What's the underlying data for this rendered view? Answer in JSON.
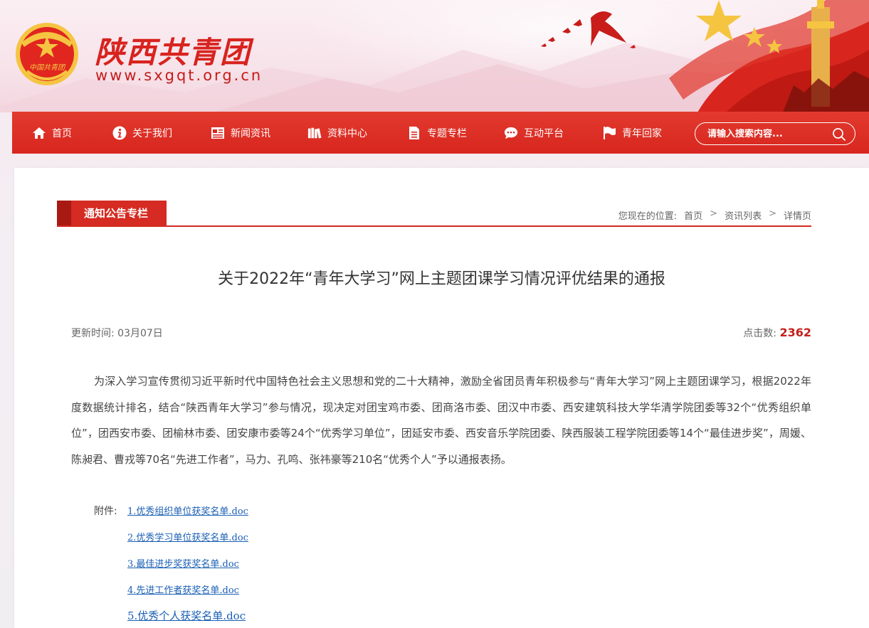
{
  "header": {
    "site_title": "陕西共青团",
    "site_url": "www.sxgqt.org.cn",
    "emblem_text": "中国共青团"
  },
  "nav": {
    "items": [
      {
        "label": "首页",
        "icon": "home-icon"
      },
      {
        "label": "关于我们",
        "icon": "info-icon"
      },
      {
        "label": "新闻资讯",
        "icon": "news-icon"
      },
      {
        "label": "资料中心",
        "icon": "books-icon"
      },
      {
        "label": "专题专栏",
        "icon": "document-icon"
      },
      {
        "label": "互动平台",
        "icon": "chat-icon"
      },
      {
        "label": "青年回家",
        "icon": "flag-icon"
      }
    ],
    "search_placeholder": "请输入搜索内容..."
  },
  "section": {
    "tab_label": "通知公告专栏",
    "breadcrumb_prefix": "您现在的位置:",
    "breadcrumb": [
      "首页",
      "资讯列表",
      "详情页"
    ],
    "breadcrumb_sep": ">"
  },
  "article": {
    "title": "关于2022年“青年大学习”网上主题团课学习情况评优结果的通报",
    "update_label": "更新时间:",
    "update_date": "03月07日",
    "clicks_label": "点击数:",
    "clicks": "2362",
    "body": "为深入学习宣传贯彻习近平新时代中国特色社会主义思想和党的二十大精神，激励全省团员青年积极参与“青年大学习”网上主题团课学习，根据2022年度数据统计排名，结合“陕西青年大学习”参与情况，现决定对团宝鸡市委、团商洛市委、团汉中市委、西安建筑科技大学华清学院团委等32个“优秀组织单位”，团西安市委、团榆林市委、团安康市委等24个“优秀学习单位”，团延安市委、西安音乐学院团委、陕西服装工程学院团委等14个“最佳进步奖”，周媛、陈昶君、曹戎等70名“先进工作者”，马力、孔鸣、张祎豪等210名“优秀个人”予以通报表扬。",
    "attach_label": "附件:",
    "attachments": [
      "1.优秀组织单位获奖名单.doc",
      "2.优秀学习单位获奖名单.doc",
      "3.最佳进步奖获奖名单.doc",
      "4.先进工作者获奖名单.doc",
      "5.优秀个人获奖名单.doc"
    ]
  },
  "colors": {
    "brand_red": "#d8261f",
    "link_blue": "#1a5fb4",
    "clicks_red": "#c4201a"
  }
}
